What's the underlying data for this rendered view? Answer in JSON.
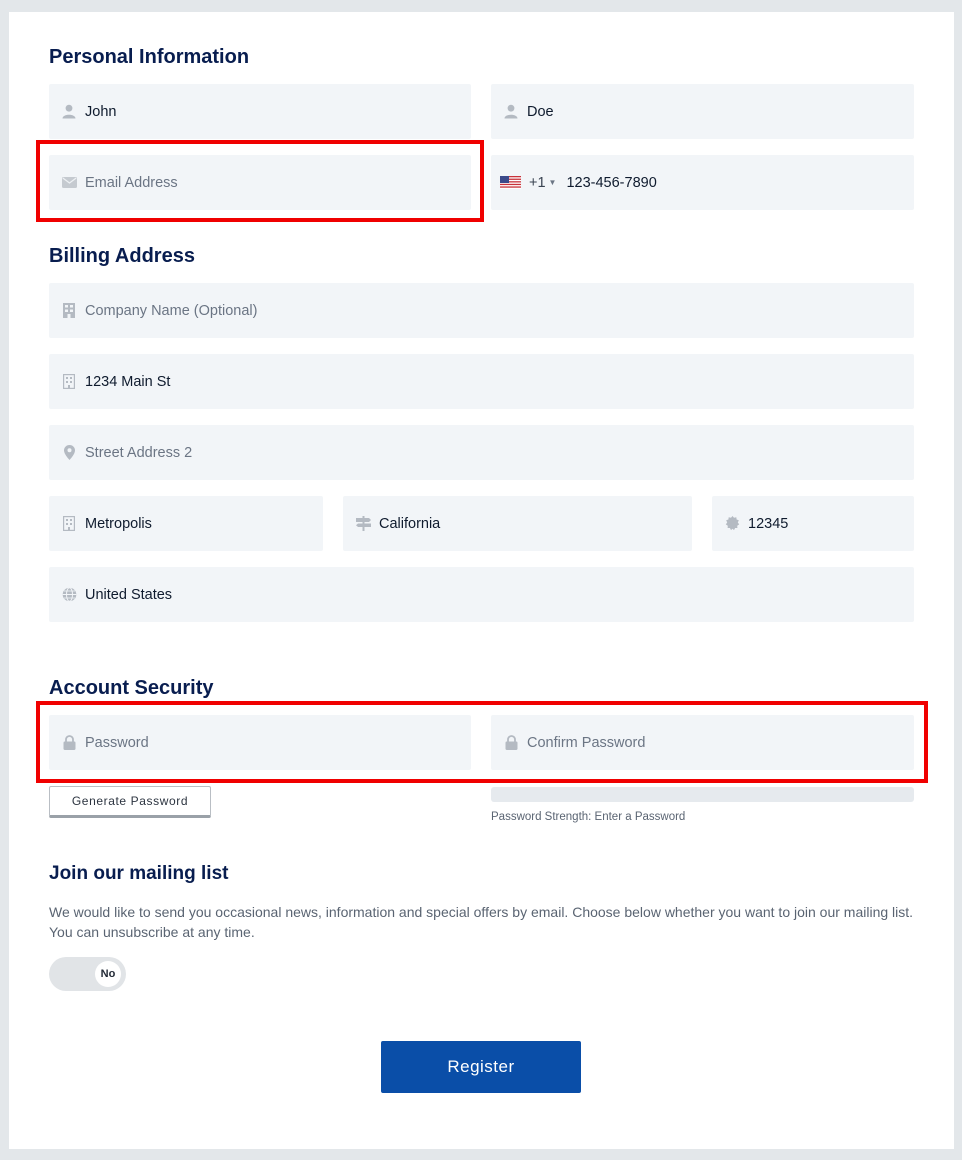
{
  "sections": {
    "personal": "Personal Information",
    "billing": "Billing Address",
    "security": "Account Security",
    "mailing": "Join our mailing list"
  },
  "personal": {
    "first_name": "John",
    "last_name": "Doe",
    "email_placeholder": "Email Address",
    "phone_code": "+1",
    "phone_number": "123-456-7890"
  },
  "billing": {
    "company_placeholder": "Company Name (Optional)",
    "street1": "1234 Main St",
    "street2_placeholder": "Street Address 2",
    "city": "Metropolis",
    "state": "California",
    "zip": "12345",
    "country": "United States"
  },
  "security": {
    "password_placeholder": "Password",
    "confirm_placeholder": "Confirm Password",
    "generate_label": "Generate Password",
    "strength_text": "Password Strength: Enter a Password",
    "strength_fraction": 0
  },
  "mailing": {
    "description": "We would like to send you occasional news, information and special offers by email. Choose below whether you want to join our mailing list. You can unsubscribe at any time.",
    "toggle_label": "No"
  },
  "register_label": "Register",
  "colors": {
    "accent": "#0a4ea8",
    "heading": "#081d4f",
    "field_bg": "#f2f5f8",
    "highlight": "#f00000"
  },
  "icons": {
    "first_name": "user-icon",
    "last_name": "user-icon",
    "email": "envelope-icon",
    "company": "building-icon",
    "street1": "building-icon",
    "street2": "map-pin-icon",
    "city": "building-icon",
    "state": "signpost-icon",
    "zip": "badge-icon",
    "country": "globe-icon",
    "password": "lock-icon"
  }
}
